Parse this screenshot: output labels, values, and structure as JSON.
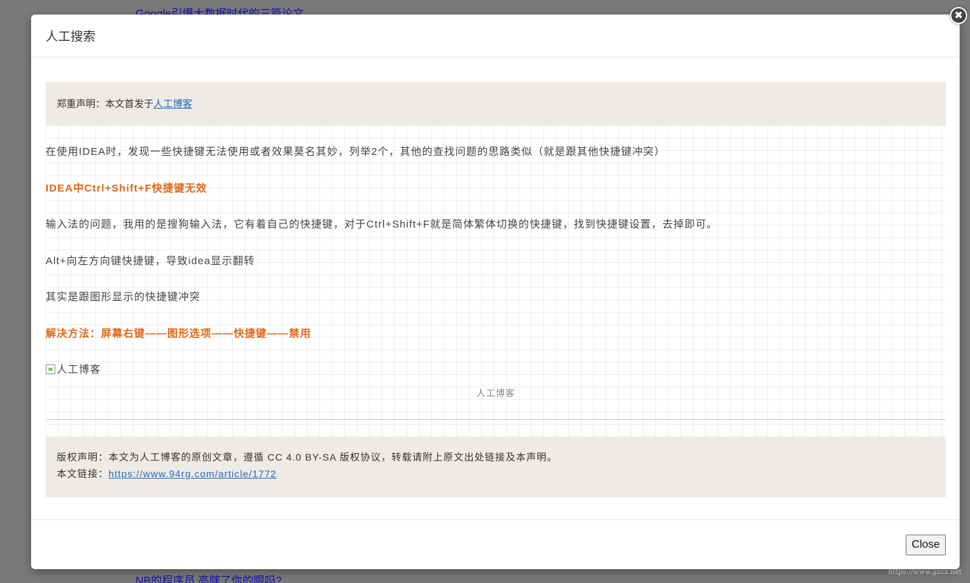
{
  "background": {
    "top_link": "Google引爆大数据时代的三篇论文",
    "bottom_link": "NB的程序员,亮瞎了你的眼吗?"
  },
  "watermark": "https://www.gzcx.net",
  "modal": {
    "title": "人工搜索",
    "close_icon": "✖",
    "notice": {
      "prefix": "郑重声明：本文首发于",
      "link": "人工博客"
    },
    "paragraphs": {
      "p1": "在使用IDEA时，发现一些快捷键无法使用或者效果莫名其妙，列举2个，其他的查找问题的思路类似（就是跟其他快捷键冲突）",
      "h1": "IDEA中Ctrl+Shift+F快捷键无效",
      "p2": "输入法的问题，我用的是搜狗输入法，它有着自己的快捷键，对于Ctrl+Shift+F就是简体繁体切换的快捷键，找到快捷键设置，去掉即可。",
      "p3": "Alt+向左方向键快捷键，导致idea显示翻转",
      "p4": "其实是跟图形显示的快捷键冲突",
      "h2": "解决方法：屏幕右键——图形选项——快捷键——禁用"
    },
    "image_alt": "人工博客",
    "caption": "人工博客",
    "copyright": {
      "line1": "版权声明：本文为人工博客的原创文章，遵循 CC 4.0 BY-SA 版权协议，转载请附上原文出处链接及本声明。",
      "link_label": "本文链接：",
      "link": "https://www.94rg.com/article/1772"
    },
    "close_button": "Close"
  },
  "colors": {
    "accent_orange": "#e0681a",
    "link_blue": "#1e6ac0",
    "notice_bg": "#eeeae6",
    "overlay": "#7a7a7a"
  }
}
